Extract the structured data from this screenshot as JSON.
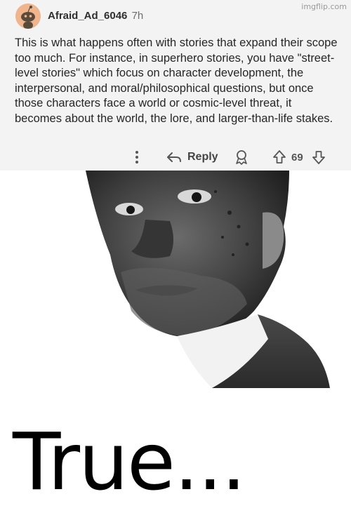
{
  "watermark": "imgflip.com",
  "comment": {
    "author": "Afraid_Ad_6046",
    "age": "7h",
    "body": "This is what happens often with stories that expand their scope too much. For instance, in superhero stories, you have \"street-level stories\" which focus on character development, the interpersonal, and moral/philosophical questions, but once those characters face a world or cosmic-level threat, it becomes about the world, the lore, and larger-than-life stakes.",
    "actions": {
      "more_icon": "vertical-ellipsis-icon",
      "reply_label": "Reply",
      "reply_icon": "reply-arrow-icon",
      "award_icon": "award-icon",
      "upvote_icon": "arrow-up-icon",
      "score": "69",
      "downvote_icon": "arrow-down-icon"
    },
    "avatar_color": "#f0b58c"
  },
  "caption": "True..."
}
